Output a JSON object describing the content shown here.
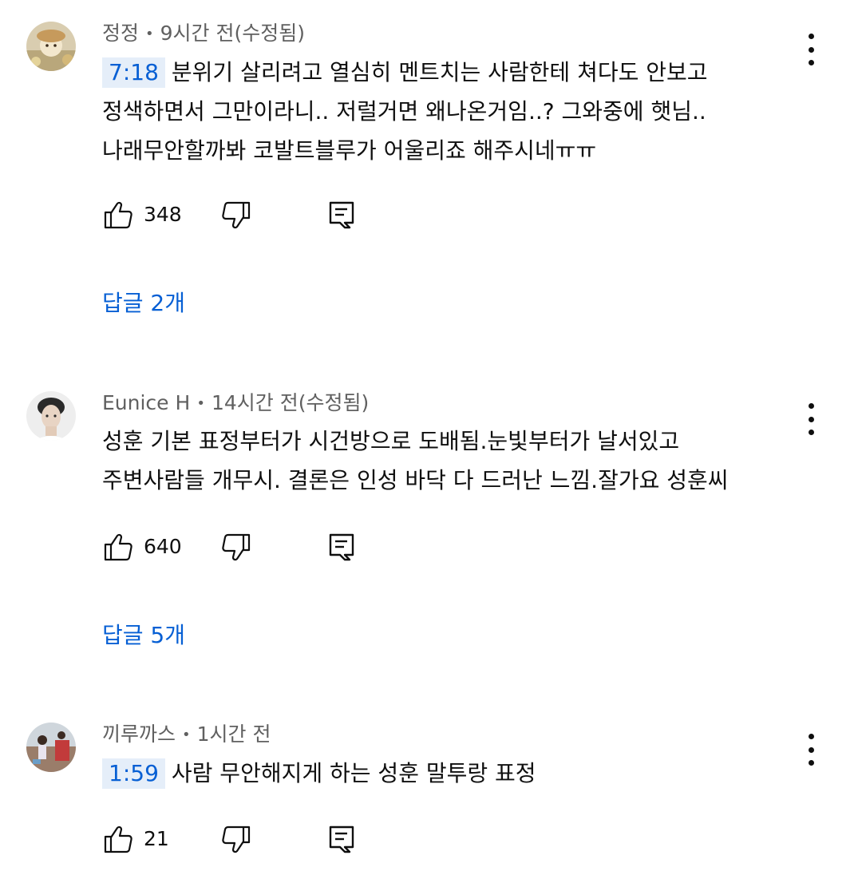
{
  "comments": [
    {
      "author": "정정",
      "time": "9시간 전(수정됨)",
      "timestamp": "7:18",
      "lines": [
        "분위기 살리려고 열심히 멘트치는 사람한테 쳐다도 안보고",
        "정색하면서 그만이라니.. 저럴거면 왜나온거임..? 그와중에 햇님..",
        "나래무안할까봐 코발트블루가 어울리죠 해주시네ㅠㅠ"
      ],
      "likes": "348",
      "replies": "답글 2개"
    },
    {
      "author": "Eunice H",
      "time": "14시간 전(수정됨)",
      "lines": [
        "성훈 기본 표정부터가 시건방으로 도배됨.눈빛부터가 날서있고",
        "주변사람들 개무시. 결론은 인성 바닥 다 드러난 느낌.잘가요 성훈씨"
      ],
      "likes": "640",
      "replies": "답글 5개"
    },
    {
      "author": "끼루까스",
      "time": "1시간 전",
      "timestamp": "1:59",
      "lines": [
        "사람 무안해지게 하는 성훈 말투랑 표정"
      ],
      "likes": "21"
    }
  ],
  "separator": "•",
  "icons": {
    "like": "thumb-up-icon",
    "dislike": "thumb-down-icon",
    "reply": "reply-comment-icon",
    "more": "more-vertical-icon"
  },
  "colors": {
    "link": "#065fd4",
    "timestamp_bg": "#e5eef9",
    "meta": "#606060"
  }
}
